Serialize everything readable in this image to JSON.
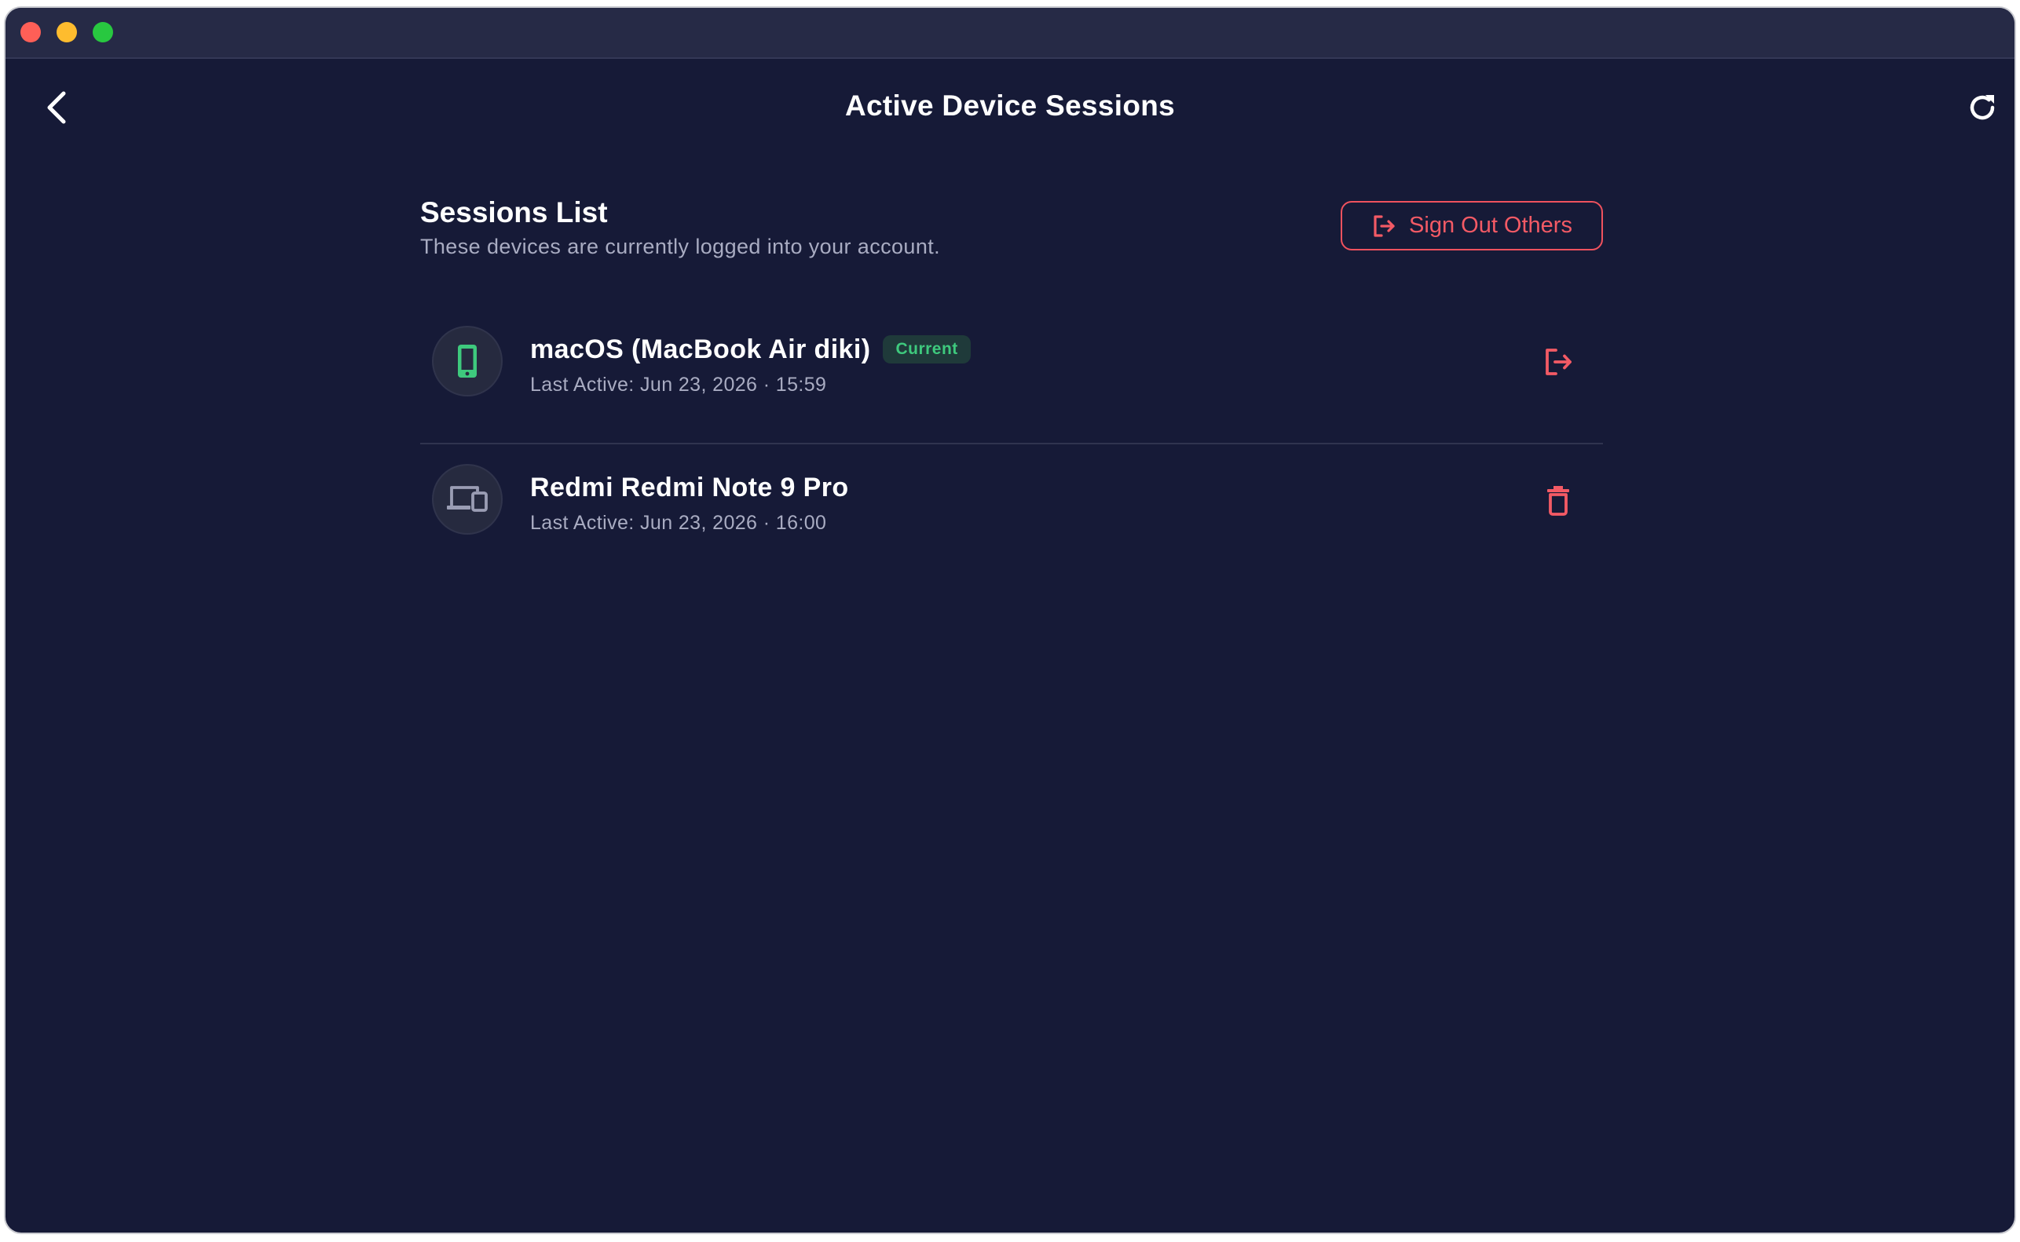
{
  "header": {
    "title": "Active Device Sessions",
    "back_icon": "chevron-left-icon",
    "refresh_icon": "refresh-icon"
  },
  "sessions_section": {
    "title": "Sessions List",
    "subtitle": "These devices are currently logged into your account.",
    "sign_out_others_label": "Sign Out Others"
  },
  "sessions": [
    {
      "device_name": "macOS (MacBook Air diki)",
      "badge": "Current",
      "last_active": "Last Active: Jun 23, 2026 · 15:59",
      "icon": "smartphone-icon",
      "action_icon": "logout-icon"
    },
    {
      "device_name": "Redmi Redmi Note 9 Pro",
      "last_active": "Last Active: Jun 23, 2026 · 16:00",
      "icon": "devices-icon",
      "action_icon": "trash-icon"
    }
  ],
  "colors": {
    "background": "#161a37",
    "titlebar": "#262a46",
    "danger": "#f35a65",
    "success": "#3ec97d",
    "muted_text": "#a9acc2"
  }
}
